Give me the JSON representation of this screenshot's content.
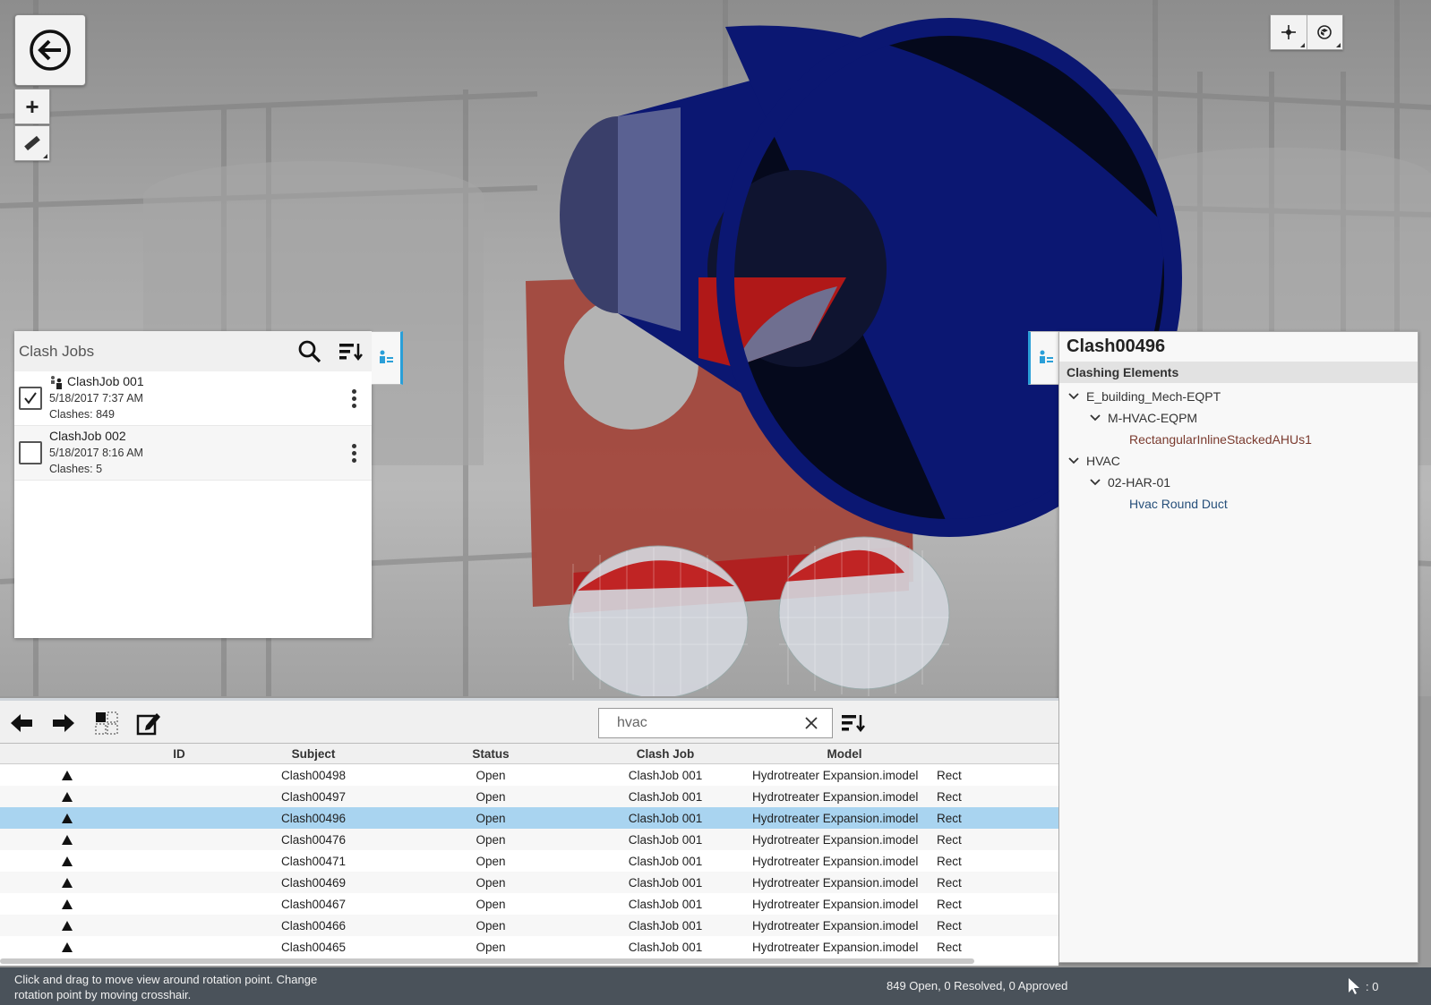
{
  "jobs_panel": {
    "title": "Clash Jobs",
    "jobs": [
      {
        "name": "ClashJob 001",
        "date": "5/18/2017 7:37 AM",
        "clashes": "Clashes: 849",
        "checked": true
      },
      {
        "name": "ClashJob 002",
        "date": "5/18/2017 8:16 AM",
        "clashes": "Clashes: 5",
        "checked": false
      }
    ]
  },
  "details": {
    "title": "Clash00496",
    "section": "Clashing Elements",
    "tree": [
      {
        "label": "E_building_Mech-EQPT",
        "level": 0,
        "kind": "node"
      },
      {
        "label": "M-HVAC-EQPM",
        "level": 1,
        "kind": "node"
      },
      {
        "label": "RectangularInlineStackedAHUs1",
        "level": 2,
        "kind": "leaf-red"
      },
      {
        "label": "HVAC",
        "level": 0,
        "kind": "node"
      },
      {
        "label": "02-HAR-01",
        "level": 1,
        "kind": "node"
      },
      {
        "label": "Hvac Round Duct",
        "level": 2,
        "kind": "leaf-blue"
      }
    ]
  },
  "toolbar": {
    "search_value": "hvac"
  },
  "grid": {
    "headers": {
      "id": "ID",
      "subject": "Subject",
      "status": "Status",
      "clash_job": "Clash Job",
      "model": "Model"
    },
    "rows": [
      {
        "subject": "Clash00498",
        "status": "Open",
        "job": "ClashJob 001",
        "model": "Hydrotreater Expansion.imodel",
        "rest": "Rect",
        "selected": false
      },
      {
        "subject": "Clash00497",
        "status": "Open",
        "job": "ClashJob 001",
        "model": "Hydrotreater Expansion.imodel",
        "rest": "Rect",
        "selected": false
      },
      {
        "subject": "Clash00496",
        "status": "Open",
        "job": "ClashJob 001",
        "model": "Hydrotreater Expansion.imodel",
        "rest": "Rect",
        "selected": true
      },
      {
        "subject": "Clash00476",
        "status": "Open",
        "job": "ClashJob 001",
        "model": "Hydrotreater Expansion.imodel",
        "rest": "Rect",
        "selected": false
      },
      {
        "subject": "Clash00471",
        "status": "Open",
        "job": "ClashJob 001",
        "model": "Hydrotreater Expansion.imodel",
        "rest": "Rect",
        "selected": false
      },
      {
        "subject": "Clash00469",
        "status": "Open",
        "job": "ClashJob 001",
        "model": "Hydrotreater Expansion.imodel",
        "rest": "Rect",
        "selected": false
      },
      {
        "subject": "Clash00467",
        "status": "Open",
        "job": "ClashJob 001",
        "model": "Hydrotreater Expansion.imodel",
        "rest": "Rect",
        "selected": false
      },
      {
        "subject": "Clash00466",
        "status": "Open",
        "job": "ClashJob 001",
        "model": "Hydrotreater Expansion.imodel",
        "rest": "Rect",
        "selected": false
      },
      {
        "subject": "Clash00465",
        "status": "Open",
        "job": "ClashJob 001",
        "model": "Hydrotreater Expansion.imodel",
        "rest": "Rect",
        "selected": false
      }
    ]
  },
  "statusbar": {
    "hint": "Click and drag to move view around rotation point. Change rotation point by moving crosshair.",
    "summary": "849 Open, 0 Resolved, 0 Approved",
    "selection_count": ": 0"
  },
  "colors": {
    "accent": "#2a9fd8",
    "selected_row": "#a9d4f0",
    "duct_blue": "#0a1670",
    "equipment_red": "#a2473c",
    "status_bg": "#4a525a"
  }
}
